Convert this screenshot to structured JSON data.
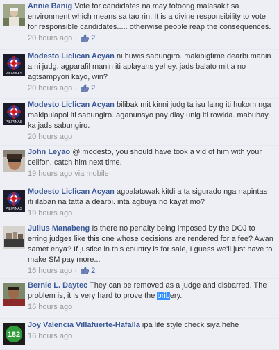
{
  "comments": [
    {
      "author": "Annie Banig",
      "text": "Vote for candidates na may totoong malasakit sa environment which means sa tao rin. It is a divine responsibility to vote for responsible candidates..... otherwise people reap the consequences.",
      "time": "20 hours ago",
      "separator": "·",
      "likes": "2",
      "avatar_icon": "person-photo-icon"
    },
    {
      "author": "Modesto Liclican Acyan",
      "text": "ni huwis sabungiro. makibigtime dearbi manin a ni judg. agparafil manin iti aplayans yehey. jads balato mit a no agtsampyon kayo, win?",
      "time": "20 hours ago",
      "separator": "·",
      "likes": "2",
      "avatar_icon": "pilipinas-emblem-icon"
    },
    {
      "author": "Modesto Liclican Acyan",
      "text": "bilibak mit kinni judg ta isu laing iti hukom nga makipulapol iti sabungiro. aganunsyo pay diay unig iti rowida. mabuhay ka jads sabungiro.",
      "time": "20 hours ago",
      "separator": "",
      "likes": "",
      "avatar_icon": "pilipinas-emblem-icon"
    },
    {
      "author": "John Leyao",
      "text": "@ modesto, you should have took a vid of him with your cellfon, catch him next time.",
      "time": "19 hours ago via mobile",
      "separator": "",
      "likes": "",
      "avatar_icon": "person-photo-icon"
    },
    {
      "author": "Modesto Liclican Acyan",
      "text": "agbalatowak kitdi a ta sigurado nga napintas iti ilaban na tatta a dearbi. inta agbuya no kayat mo?",
      "time": "19 hours ago",
      "separator": "",
      "likes": "",
      "avatar_icon": "pilipinas-emblem-icon"
    },
    {
      "author": "Julius Manabeng",
      "text": "Is there no penalty being imposed by the DOJ to erring judges like this one whose decisions are rendered for a fee? Awan samet enya? If justice in this country is for sale, I guess we'll just have to make SM pay more...",
      "time": "16 hours ago",
      "separator": "·",
      "likes": "2",
      "avatar_icon": "person-photo-icon"
    },
    {
      "author": "Bernie L. Daytec",
      "text_before": "They can be removed as a judge and disbarred. The problem is, it is very hard to prove the ",
      "text_selected": "brib",
      "text_after": "ery.",
      "time": "16 hours ago",
      "separator": "",
      "likes": "",
      "avatar_icon": "person-photo-icon"
    },
    {
      "author": "Joy Valencia Villafuerte-Hafalla",
      "text": "ipa life style check siya,hehe",
      "time": "16 hours ago",
      "separator": "",
      "likes": "",
      "avatar_icon": "green-logo-icon",
      "avatar_text": "182"
    }
  ],
  "like_icon": "thumbs-up-icon",
  "avatar_label": "PILIPINAS",
  "colors": {
    "link": "#3b5998",
    "meta": "#999999",
    "background": "#edeff4",
    "selection": "#3390ff"
  }
}
